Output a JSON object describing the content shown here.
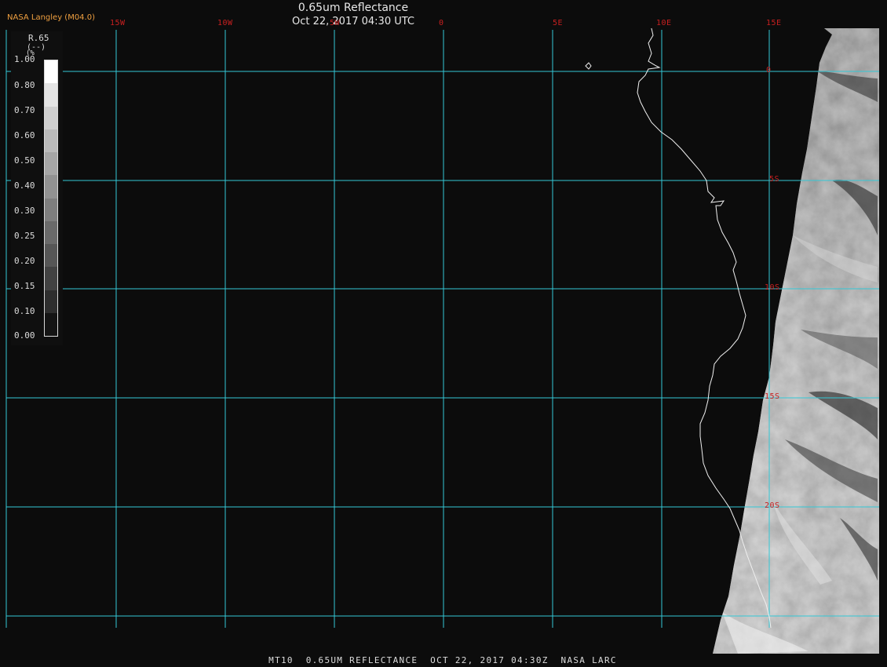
{
  "header": {
    "title": "0.65um Reflectance",
    "datetime": "Oct 22, 2017 04:30 UTC",
    "producer": "NASA Langley (M04.0)"
  },
  "longitude_labels": [
    "15W",
    "10W",
    "5W",
    "0",
    "5E",
    "10E",
    "15E"
  ],
  "latitude_labels": [
    "0",
    "5S",
    "10S",
    "15S",
    "20S"
  ],
  "colorbar": {
    "variable": "R.65",
    "units": "(--)",
    "unit_letter": "(%",
    "ticks": [
      "1.00",
      "0.80",
      "0.70",
      "0.60",
      "0.50",
      "0.40",
      "0.30",
      "0.25",
      "0.20",
      "0.15",
      "0.10",
      "0.00"
    ],
    "steps": [
      "#ffffff",
      "#e4e4e4",
      "#cfcfcf",
      "#bababa",
      "#a6a6a6",
      "#929292",
      "#7e7e7e",
      "#6a6a6a",
      "#565656",
      "#424242",
      "#2e2e2e",
      "#141414"
    ]
  },
  "footer": "MT10  0.65UM REFLECTANCE  OCT 22, 2017 04:30Z  NASA LARC",
  "colors": {
    "grid": "#33c8d6",
    "coast": "#f0f0f0",
    "label": "#c82020",
    "background": "#0c0c0c"
  },
  "map": {
    "projection": "lat/lon",
    "lon_range": [
      "15W",
      "15E"
    ],
    "lat_range": [
      "0",
      "20S"
    ],
    "scene": "satellite visible reflectance, SW Africa coast (Gabon to Namibia)"
  }
}
